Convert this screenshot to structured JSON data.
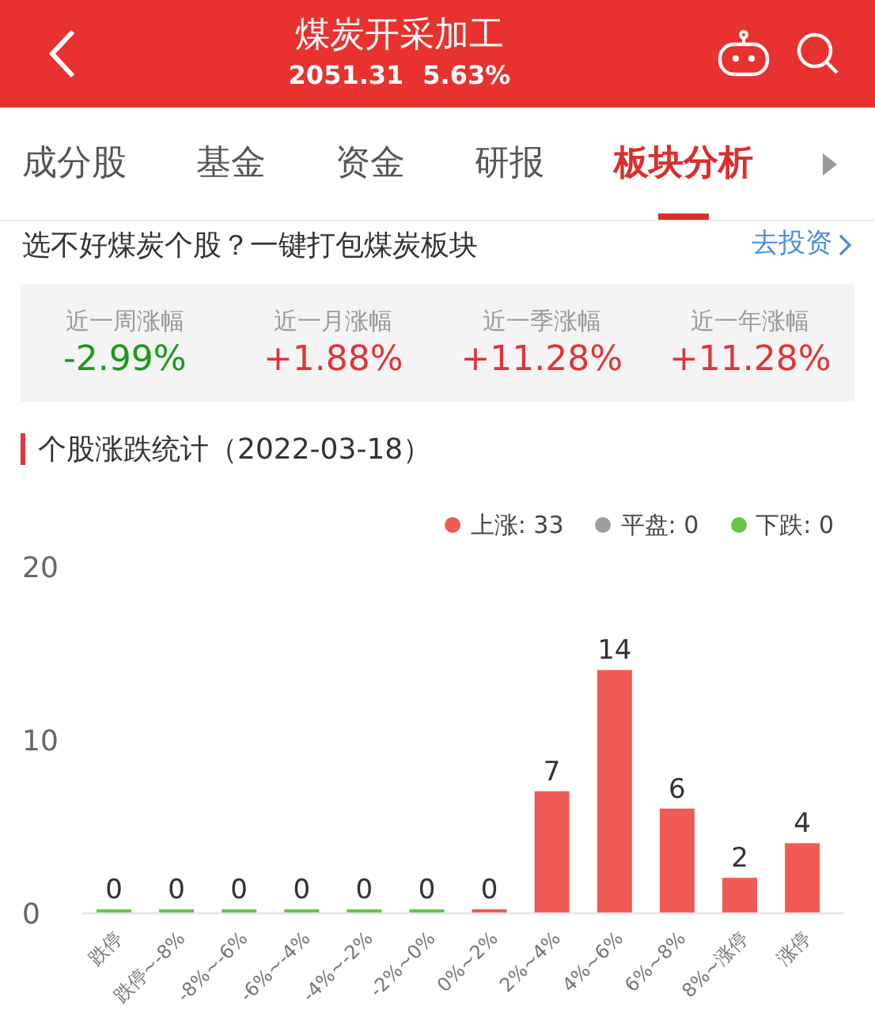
{
  "header": {
    "title": "煤炭开采加工",
    "price": "2051.31",
    "change": "5.63%"
  },
  "tabs": [
    {
      "label": "成分股",
      "selected": false
    },
    {
      "label": "基金",
      "selected": false
    },
    {
      "label": "资金",
      "selected": false
    },
    {
      "label": "研报",
      "selected": false
    },
    {
      "label": "板块分析",
      "selected": true
    }
  ],
  "promo": {
    "text": "选不好煤炭个股？一键打包煤炭板块",
    "link": "去投资"
  },
  "returns": [
    {
      "label": "近一周涨幅",
      "value": "-2.99%",
      "color": "#1a9a1a"
    },
    {
      "label": "近一月涨幅",
      "value": "+1.88%",
      "color": "#e0343a"
    },
    {
      "label": "近一季涨幅",
      "value": "+11.28%",
      "color": "#e0343a"
    },
    {
      "label": "近一年涨幅",
      "value": "+11.28%",
      "color": "#e0343a"
    }
  ],
  "section_title": "个股涨跌统计（2022-03-18）",
  "legend": [
    {
      "label": "上涨: 33",
      "color": "#f05a55"
    },
    {
      "label": "平盘: 0",
      "color": "#9e9e9e"
    },
    {
      "label": "下跌: 0",
      "color": "#6cc24a"
    }
  ],
  "chart": {
    "chart_data": {
      "type": "bar",
      "categories": [
        "跌停",
        "跌停~-8%",
        "-8%~-6%",
        "-6%~-4%",
        "-4%~-2%",
        "-2%~0%",
        "0%~2%",
        "2%~4%",
        "4%~6%",
        "6%~8%",
        "8%~涨停",
        "涨停"
      ],
      "series": [
        {
          "color": "#6cc24a",
          "values": [
            0,
            0,
            0,
            0,
            0,
            0,
            null,
            null,
            null,
            null,
            null,
            null
          ]
        },
        {
          "color": "#f05a55",
          "values": [
            null,
            null,
            null,
            null,
            null,
            null,
            0,
            7,
            14,
            6,
            2,
            4
          ]
        }
      ],
      "ylim": [
        0,
        20
      ],
      "yticks": [
        0,
        10,
        20
      ],
      "data_labels": true
    }
  }
}
